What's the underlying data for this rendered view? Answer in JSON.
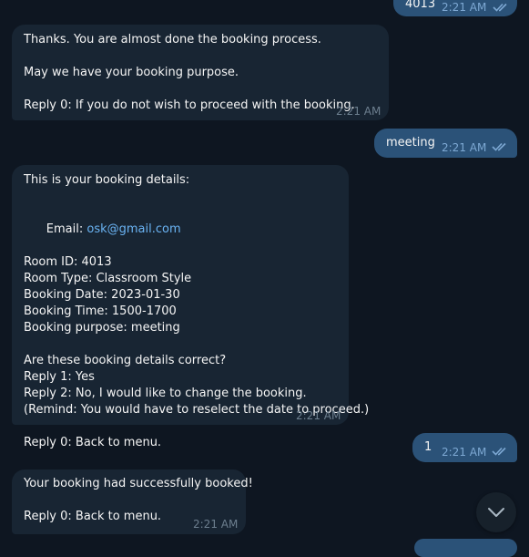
{
  "messages": {
    "m1": {
      "text": "4013",
      "time": "2:21 AM"
    },
    "m2": {
      "line1": "Thanks. You are almost done the booking process.",
      "line2": "May we have your booking purpose.",
      "line3": "Reply 0: If you do not wish to proceed with the booking.",
      "time": "2:21 AM"
    },
    "m3": {
      "text": "meeting",
      "time": "2:21 AM"
    },
    "m4": {
      "line1": "This is your booking details:",
      "email_label": "Email: ",
      "email_value": "osk@gmail.com",
      "room_id": "Room ID: 4013",
      "room_type": "Room Type: Classroom Style",
      "date": "Booking Date: 2023-01-30",
      "time_slot": "Booking Time: 1500-1700",
      "purpose": "Booking purpose: meeting",
      "question": "Are these booking details correct?",
      "reply1": "Reply 1: Yes",
      "reply2": "Reply 2: No, I would like to change the booking.",
      "remind": "(Remind: You would have to reselect the date to proceed.)",
      "reply0": "Reply 0: Back to menu.",
      "time": "2:21 AM"
    },
    "m5": {
      "text": "1",
      "time": "2:21 AM"
    },
    "m6": {
      "line1": "Your booking had successfully booked!",
      "line2": "Reply 0: Back to menu.",
      "time": "2:21 AM"
    }
  }
}
